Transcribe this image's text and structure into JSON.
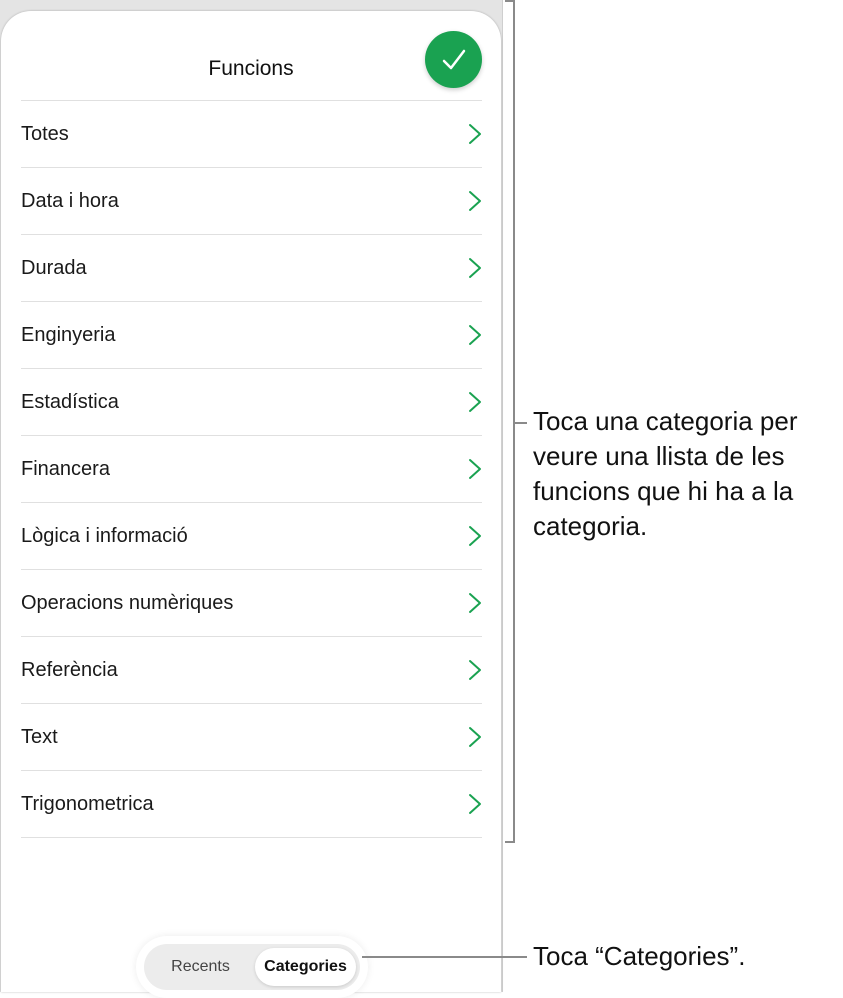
{
  "sheet": {
    "title": "Funcions"
  },
  "categories": [
    {
      "label": "Totes"
    },
    {
      "label": "Data i hora"
    },
    {
      "label": "Durada"
    },
    {
      "label": "Enginyeria"
    },
    {
      "label": "Estadística"
    },
    {
      "label": "Financera"
    },
    {
      "label": "Lògica i informació"
    },
    {
      "label": "Operacions numèriques"
    },
    {
      "label": "Referència"
    },
    {
      "label": "Text"
    },
    {
      "label": "Trigonometrica"
    }
  ],
  "segmented": {
    "recents": "Recents",
    "categories": "Categories",
    "selected": "Categories"
  },
  "callouts": {
    "categories_list": "Toca una categoria per veure una llista de les funcions que hi ha a la categoria.",
    "categories_tab": "Toca “Categories”."
  },
  "colors": {
    "accent": "#1aa251",
    "callout_line": "#8a8a8a"
  },
  "icons": {
    "done": "checkmark-icon",
    "row": "chevron-right-icon"
  }
}
